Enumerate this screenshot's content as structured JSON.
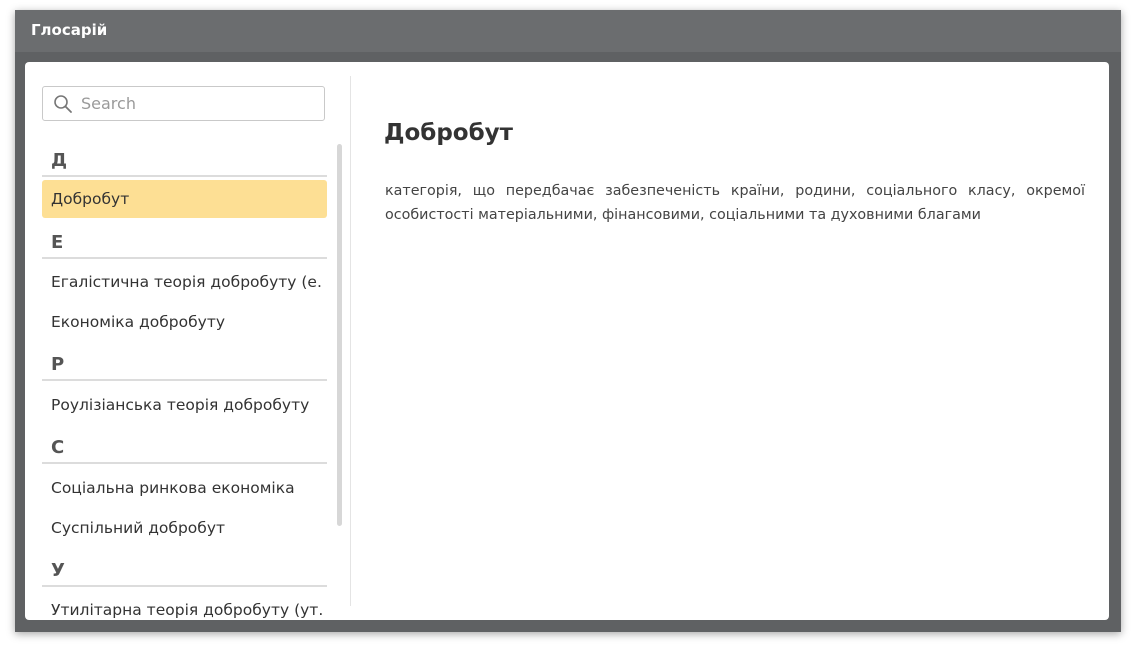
{
  "window": {
    "title": "Глосарій"
  },
  "search": {
    "placeholder": "Search",
    "value": ""
  },
  "glossary": {
    "groups": [
      {
        "letter": "Д",
        "items": [
          {
            "label": "Добробут",
            "selected": true
          }
        ]
      },
      {
        "letter": "Е",
        "items": [
          {
            "label": "Егалістична теорія добробуту (е..."
          },
          {
            "label": "Економіка добробуту"
          }
        ]
      },
      {
        "letter": "Р",
        "items": [
          {
            "label": "Роулізіанська теорія добробуту"
          }
        ]
      },
      {
        "letter": "С",
        "items": [
          {
            "label": "Соціальна ринкова економіка"
          },
          {
            "label": "Суспільний добробут"
          }
        ]
      },
      {
        "letter": "У",
        "items": [
          {
            "label": "Утилітарна теорія добробуту (ут..."
          }
        ]
      }
    ]
  },
  "content": {
    "term": "Добробут",
    "definition": "категорія, що передбачає забезпеченість країни, родини, соціального класу, окремої особистості матеріальними, фінансовими, соціальними та духовними благами"
  },
  "colors": {
    "selected_item": "#fddf94",
    "titlebar": "#6b6d6f",
    "frame": "#5f6163"
  }
}
